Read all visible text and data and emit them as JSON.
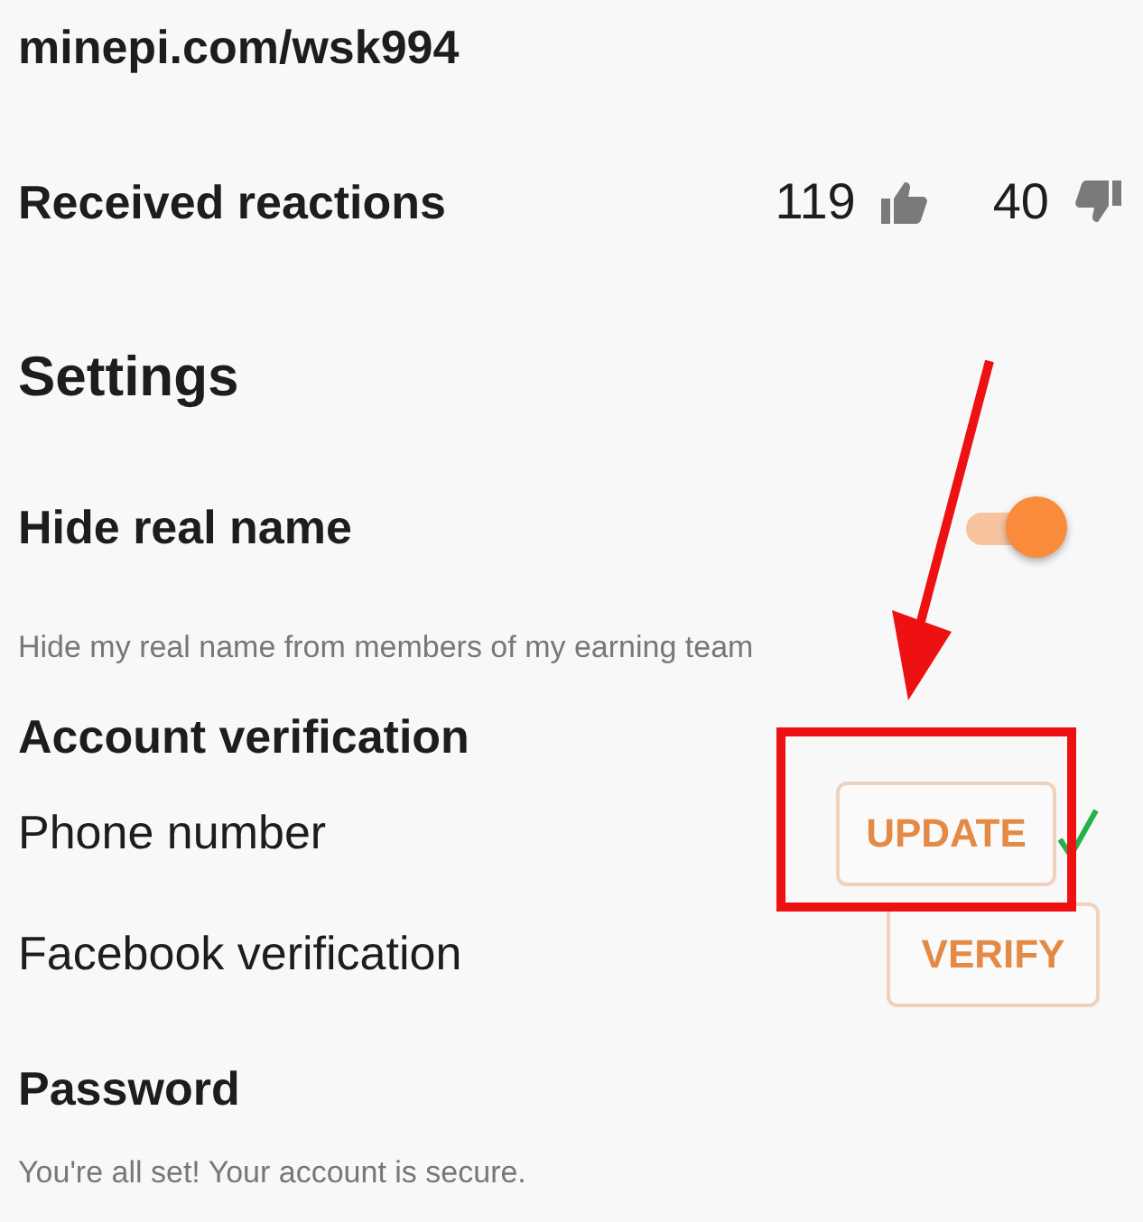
{
  "profile_link": "minepi.com/wsk994",
  "reactions": {
    "label": "Received reactions",
    "likes": "119",
    "dislikes": "40"
  },
  "settings": {
    "title": "Settings",
    "hide_real_name": {
      "label": "Hide real name",
      "on": true,
      "description": "Hide my real name from members of my earning team"
    },
    "account_verification": {
      "title": "Account verification",
      "items": [
        {
          "label": "Phone number",
          "button": "UPDATE",
          "verified": true
        },
        {
          "label": "Facebook verification",
          "button": "VERIFY",
          "verified": false
        }
      ]
    },
    "password": {
      "title": "Password",
      "description": "You're all set! Your account is secure."
    }
  }
}
